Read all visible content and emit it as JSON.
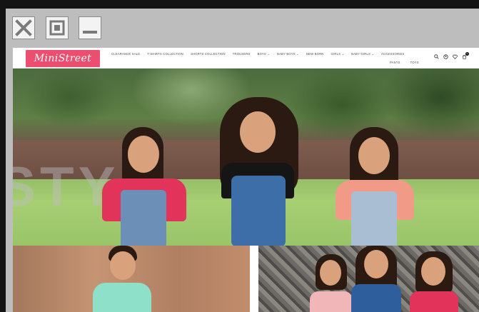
{
  "window_controls": {
    "close_icon": "close-icon",
    "maximize_icon": "maximize-icon",
    "minimize_icon": "minimize-icon"
  },
  "site": {
    "brand": "MiniStreet",
    "brand_color": "#ec4e6f",
    "nav_row1": [
      "CLEARANCE SALE",
      "T-SHIRTS COLLECTION",
      "SHORTS COLLECTION",
      "TROUSERS",
      "BOYS ⌄",
      "BABY BOYS ⌄",
      "NEW BORN",
      "GIRLS ⌄",
      "BABY GIRLS ⌄",
      "ACCESSORIES"
    ],
    "nav_row2": [
      "PANTS",
      "TOYS"
    ],
    "header_icons": [
      "search-icon",
      "user-icon",
      "heart-icon",
      "cart-icon"
    ],
    "cart_count": "0"
  },
  "hero": {
    "watermark": "STYL"
  }
}
